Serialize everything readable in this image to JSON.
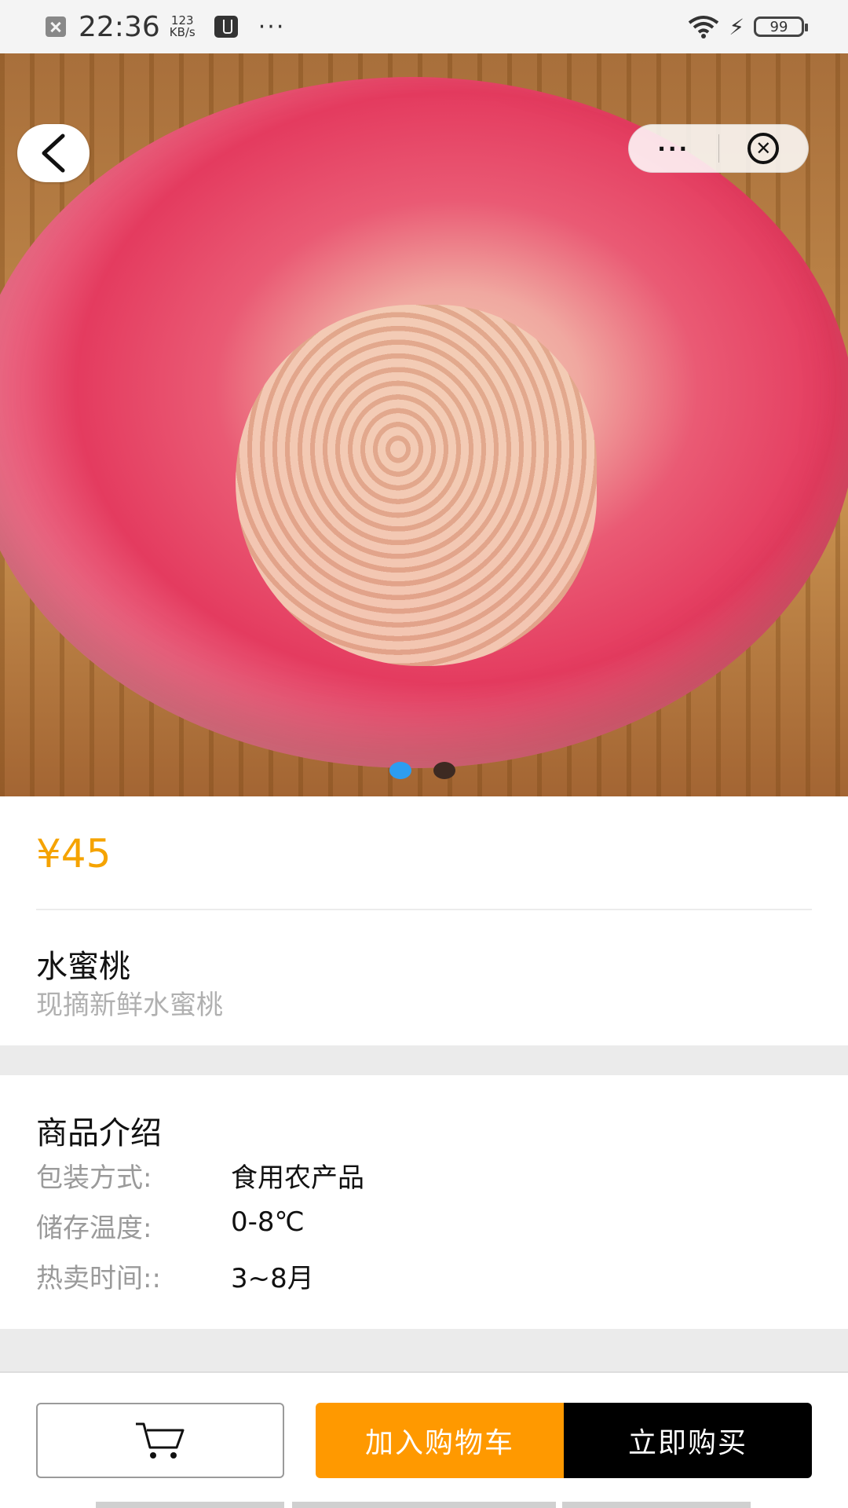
{
  "status_bar": {
    "time": "22:36",
    "speed_value": "123",
    "speed_unit": "KB/s",
    "more": "···",
    "battery": "99"
  },
  "nav": {
    "back_icon": "chevron-left-icon",
    "more": "···",
    "close_icon": "close-circle-icon"
  },
  "carousel": {
    "image": "peach-cut-photo",
    "total": 2,
    "active_index": 0
  },
  "product": {
    "price": "¥45",
    "name": "水蜜桃",
    "subtitle": "现摘新鲜水蜜桃"
  },
  "intro": {
    "title": "商品介绍",
    "specs": [
      {
        "label": "包装方式:",
        "value": "食用农产品"
      },
      {
        "label": "储存温度:",
        "value": "0-8℃"
      },
      {
        "label": "热卖时间::",
        "value": "3~8月"
      }
    ]
  },
  "actions": {
    "cart_icon": "cart-icon",
    "add_to_cart": "加入购物车",
    "buy_now": "立即购买"
  },
  "colors": {
    "price": "#f5a300",
    "add_to_cart_bg": "#ff9900",
    "buy_now_bg": "#000000",
    "active_dot": "#2d9df0"
  }
}
